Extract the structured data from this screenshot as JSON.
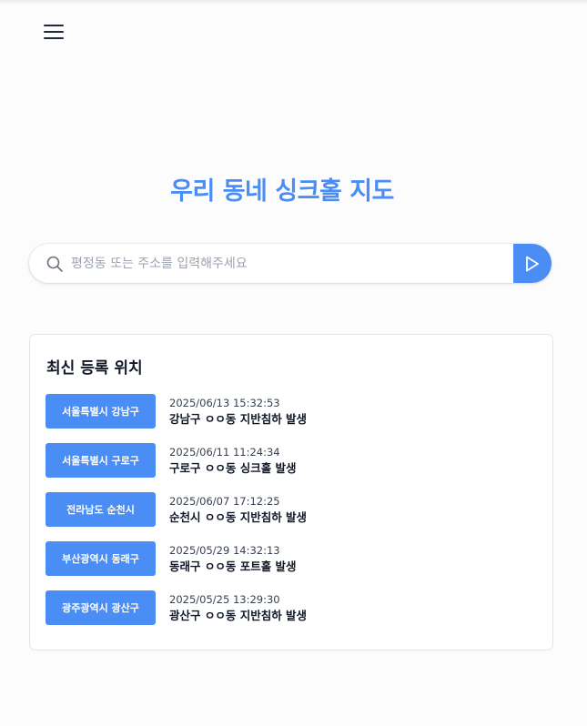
{
  "colors": {
    "accent": "#4a8ef5"
  },
  "header": {
    "menu_icon": "hamburger-menu-icon"
  },
  "main": {
    "title": "우리 동네 싱크홀 지도"
  },
  "search": {
    "placeholder": "평정동 또는 주소를 입력해주세요",
    "value": "",
    "search_icon": "magnifier-icon",
    "submit_icon": "play-triangle-icon"
  },
  "recent": {
    "title": "최신 등록 위치",
    "items": [
      {
        "region": "서울특별시 강남구",
        "time": "2025/06/13 15:32:53",
        "desc": "강남구 ㅇㅇ동 지반침하 발생"
      },
      {
        "region": "서울특별시 구로구",
        "time": "2025/06/11 11:24:34",
        "desc": "구로구 ㅇㅇ동 싱크홀 발생"
      },
      {
        "region": "전라남도 순천시",
        "time": "2025/06/07 17:12:25",
        "desc": "순천시 ㅇㅇ동 지반침하 발생"
      },
      {
        "region": "부산광역시 동래구",
        "time": "2025/05/29 14:32:13",
        "desc": "동래구 ㅇㅇ동 포트홀 발생"
      },
      {
        "region": "광주광역시 광산구",
        "time": "2025/05/25 13:29:30",
        "desc": "광산구 ㅇㅇ동 지반침하 발생"
      }
    ]
  }
}
